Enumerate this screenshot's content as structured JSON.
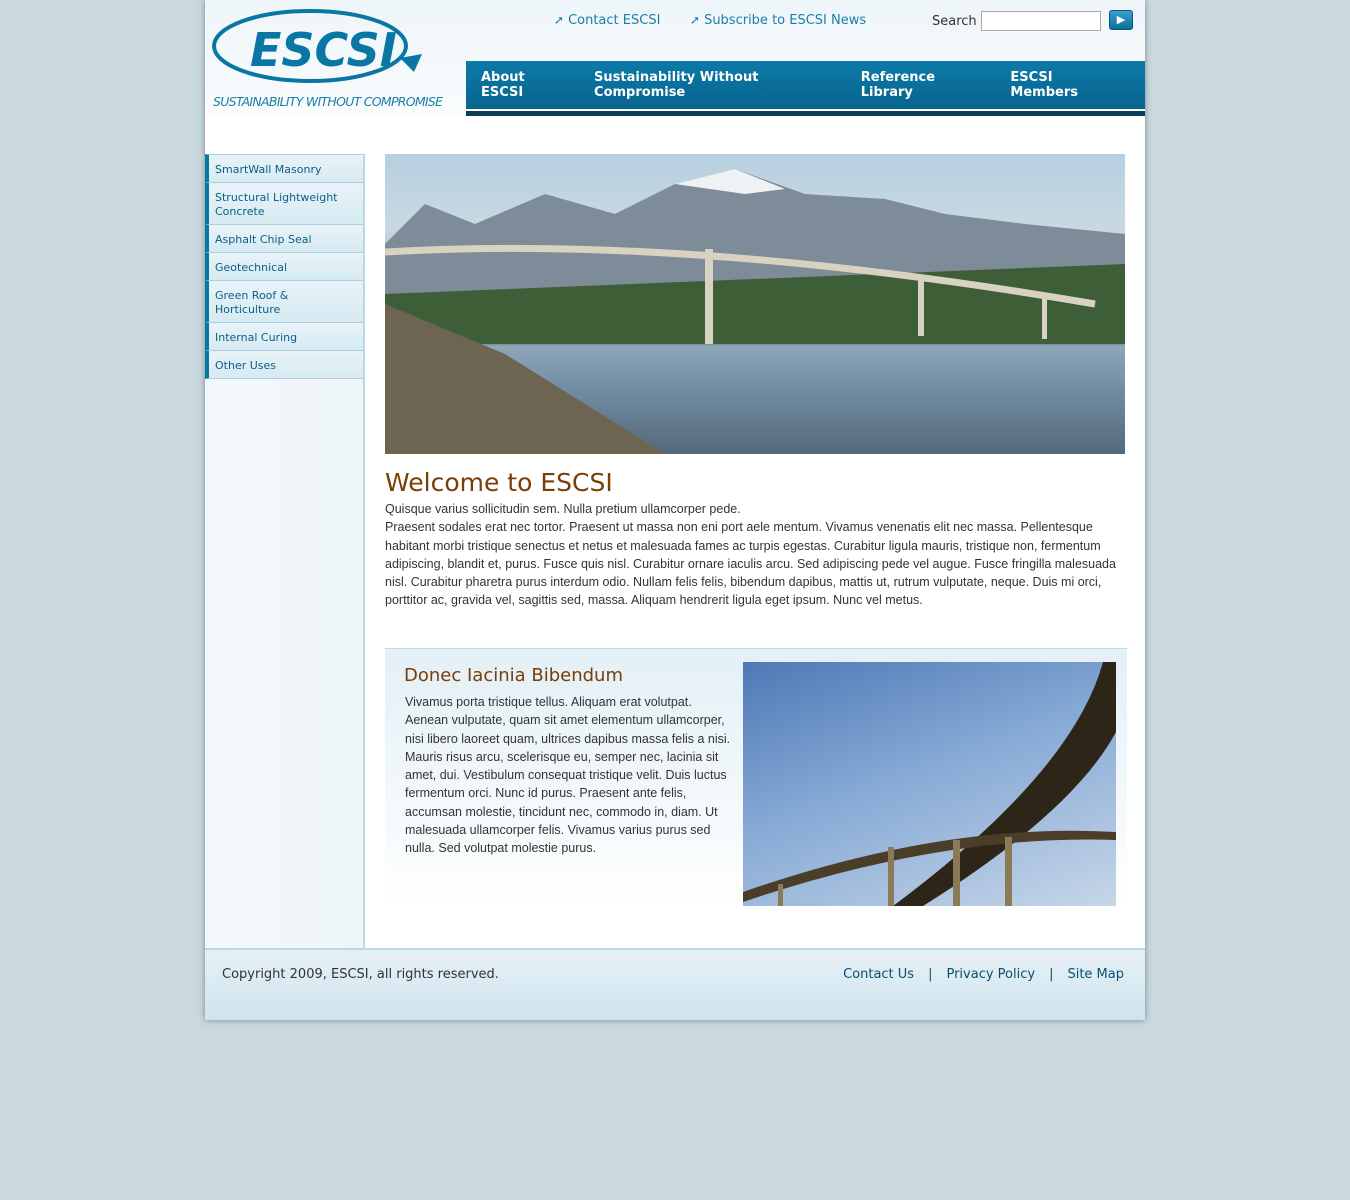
{
  "logo": {
    "text": "ESCSI",
    "tagline": "SUSTAINABILITY WITHOUT COMPROMISE"
  },
  "header": {
    "links": [
      {
        "label": "Contact ESCSI",
        "icon": "arrow-up-right-icon"
      },
      {
        "label": "Subscribe to ESCSI News",
        "icon": "arrow-up-right-icon"
      }
    ],
    "search_label": "Search",
    "search_value": "",
    "search_button_icon": "play-arrow-icon"
  },
  "nav": [
    "About ESCSI",
    "Sustainability Without Compromise",
    "Reference Library",
    "ESCSI Members"
  ],
  "sidebar": [
    "SmartWall Masonry",
    "Structural Lightweight Concrete",
    "Asphalt Chip Seal",
    "Geotechnical",
    "Green Roof & Horticulture",
    "Internal Curing",
    "Other Uses"
  ],
  "main": {
    "title": "Welcome to ESCSI",
    "paragraphs": [
      "Quisque varius sollicitudin sem.  Nulla pretium ullamcorper pede.",
      "Praesent sodales erat nec tortor.  Praesent ut massa non eni   port aele mentum.  Vivamus venenatis elit nec massa. Pellentesque habitant morbi tristique senectus et netus et malesuada fames ac turpis egestas. Curabitur ligula mauris, tristique non, fermentum adipiscing, blandit et, purus. Fusce quis nisl. Curabitur ornare iaculis arcu. Sed adipiscing pede vel augue. Fusce fringilla malesuada nisl. Curabitur pharetra purus interdum odio. Nullam felis felis, bibendum dapibus, mattis ut, rutrum vulputate, neque. Duis mi orci, porttitor ac, gravida vel, sagittis sed, massa. Aliquam hendrerit ligula eget ipsum. Nunc vel metus."
    ]
  },
  "feature": {
    "title": "Donec Iacinia Bibendum",
    "text": "Vivamus porta tristique tellus. Aliquam erat volutpat. Aenean vulputate, quam sit amet elementum ullamcorper, nisi libero laoreet quam, ultrices dapibus massa felis a nisi. Mauris risus arcu, scelerisque eu, semper nec, lacinia sit amet, dui.  Vestibulum consequat tristique velit. Duis luctus fermentum orci. Nunc id purus. Praesent ante felis, accumsan molestie, tincidunt nec, commodo in, diam. Ut malesuada ullamcorper felis. Vivamus varius purus sed nulla. Sed volutpat molestie purus."
  },
  "footer": {
    "copyright": "Copyright 2009, ESCSI, all rights reserved.",
    "links": [
      "Contact Us",
      "Privacy Policy",
      "Site Map"
    ],
    "separator": "|"
  }
}
